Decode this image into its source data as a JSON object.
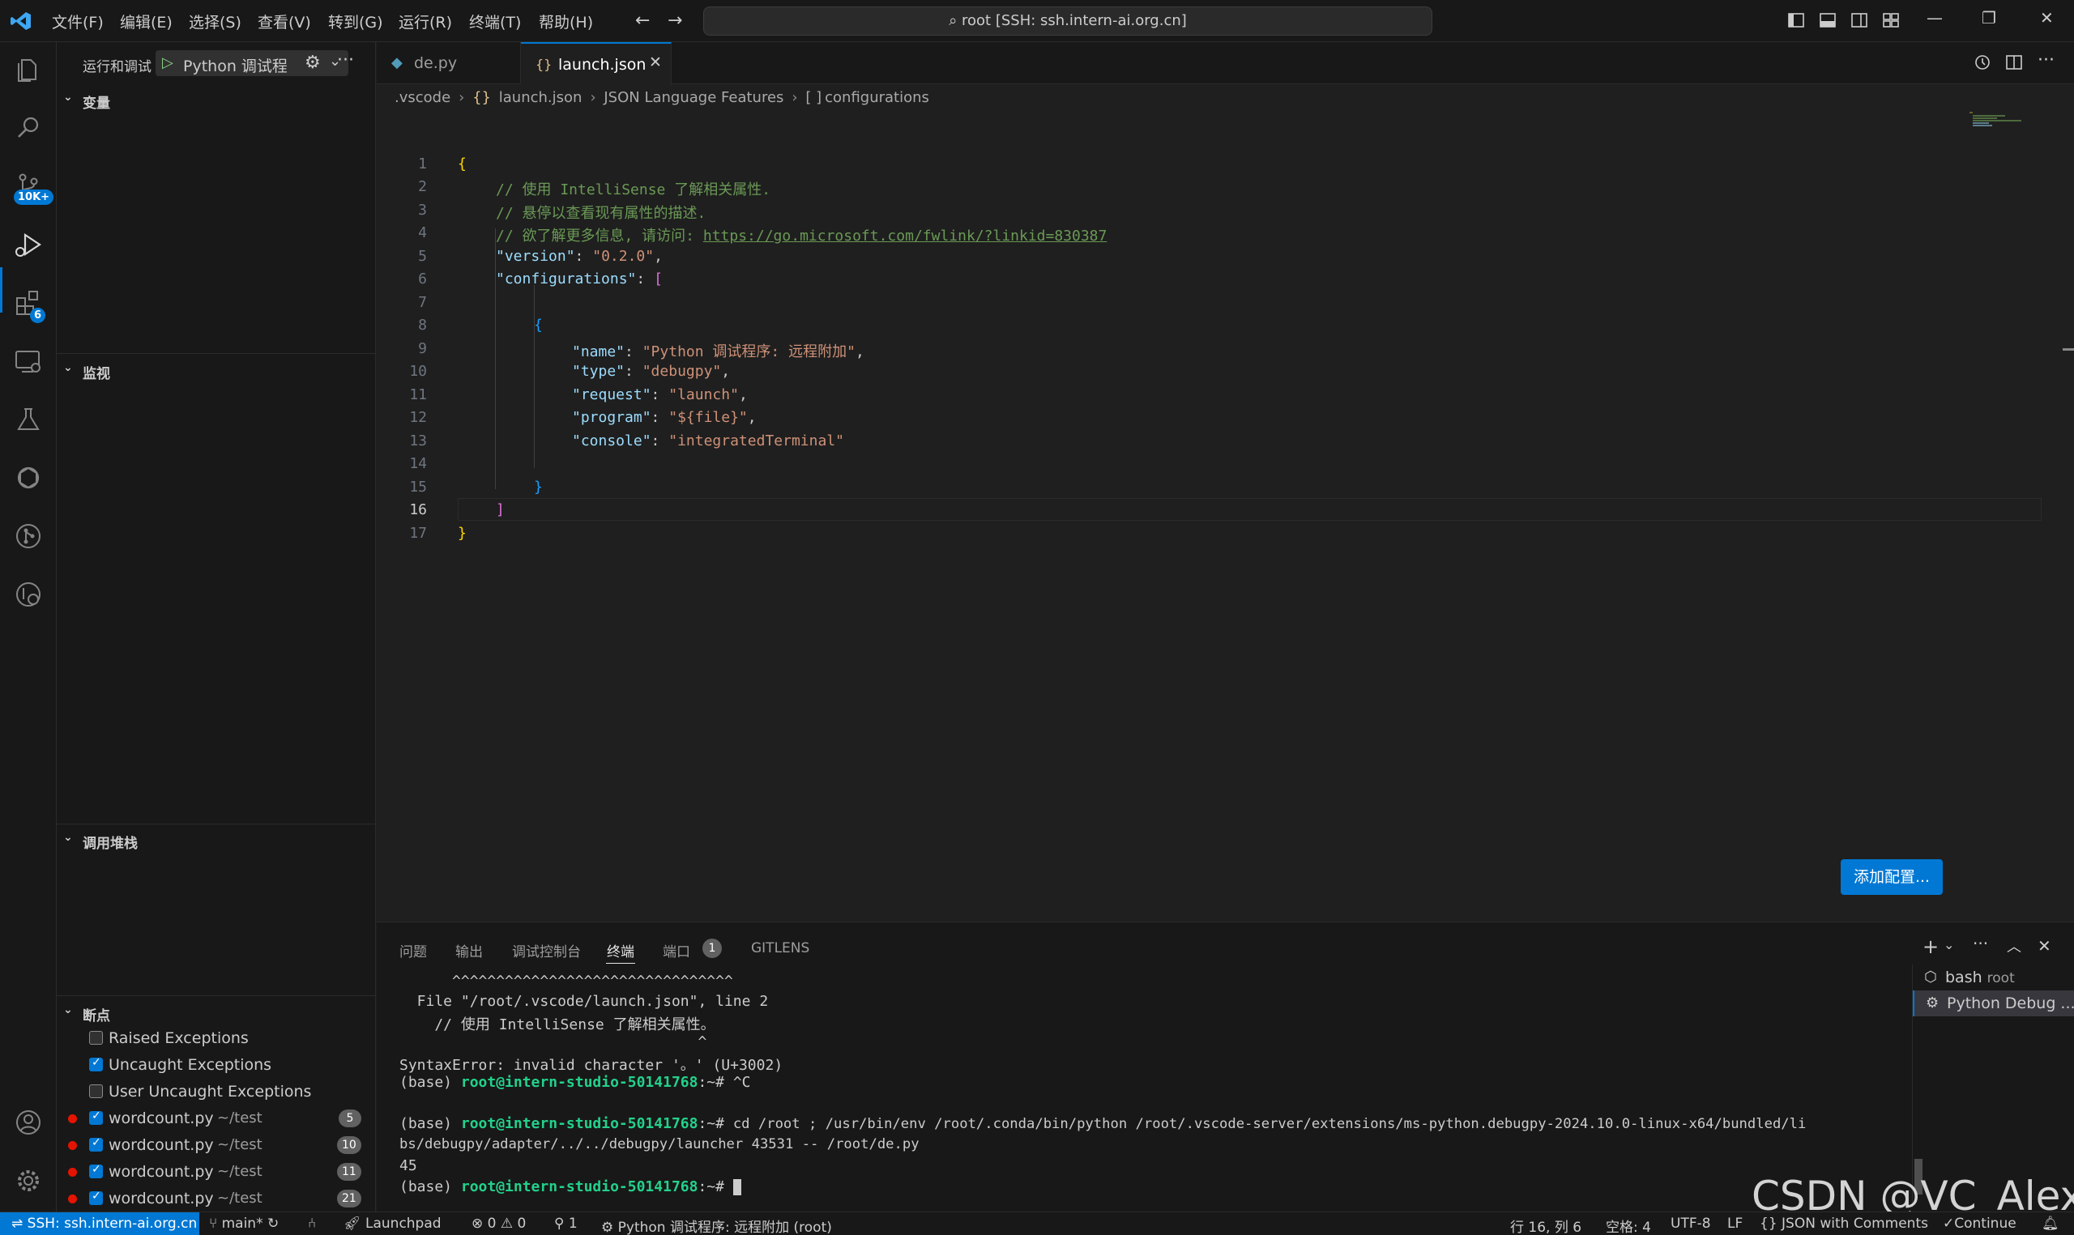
{
  "menu": [
    "文件(F)",
    "编辑(E)",
    "选择(S)",
    "查看(V)",
    "转到(G)",
    "运行(R)",
    "终端(T)",
    "帮助(H)"
  ],
  "command_center": "root [SSH: ssh.intern-ai.org.cn]",
  "activity": {
    "scm_badge": "10K+",
    "extensions_badge": "6"
  },
  "sidebar": {
    "title": "运行和调试",
    "launch_config": "Python 调试程序: 远程附加",
    "sections": {
      "variables": "变量",
      "watch": "监视",
      "callstack": "调用堆栈",
      "breakpoints": "断点"
    },
    "exceptions": [
      {
        "label": "Raised Exceptions",
        "checked": false
      },
      {
        "label": "Uncaught Exceptions",
        "checked": true
      },
      {
        "label": "User Uncaught Exceptions",
        "checked": false
      }
    ],
    "breakpoints": [
      {
        "file": "wordcount.py",
        "path": "~/test",
        "line": "5"
      },
      {
        "file": "wordcount.py",
        "path": "~/test",
        "line": "10"
      },
      {
        "file": "wordcount.py",
        "path": "~/test",
        "line": "11"
      },
      {
        "file": "wordcount.py",
        "path": "~/test",
        "line": "21"
      }
    ]
  },
  "tabs": [
    {
      "label": "de.py",
      "icon": "python-file-icon"
    },
    {
      "label": "launch.json",
      "icon": "json-file-icon"
    }
  ],
  "breadcrumb": [
    ".vscode",
    "launch.json",
    "JSON Language Features",
    "configurations"
  ],
  "code": {
    "line_numbers": [
      "1",
      "2",
      "3",
      "4",
      "5",
      "6",
      "7",
      "8",
      "9",
      "10",
      "11",
      "12",
      "13",
      "14",
      "15",
      "16",
      "17"
    ],
    "l1": "{",
    "l2": "// 使用 IntelliSense 了解相关属性.",
    "l3": "// 悬停以查看现有属性的描述.",
    "l4_comment": "// 欲了解更多信息, 请访问: ",
    "l4_link": "https://go.microsoft.com/fwlink/?linkid=830387",
    "l5_key": "\"version\"",
    "l5_val": "\"0.2.0\"",
    "l6_key": "\"configurations\"",
    "l6_open": "[",
    "l8": "{",
    "l9_key": "\"name\"",
    "l9_val": "\"Python 调试程序: 远程附加\"",
    "l10_key": "\"type\"",
    "l10_val": "\"debugpy\"",
    "l11_key": "\"request\"",
    "l11_val": "\"launch\"",
    "l12_key": "\"program\"",
    "l12_val": "\"${file}\"",
    "l13_key": "\"console\"",
    "l13_val": "\"integratedTerminal\"",
    "l15": "}",
    "l16": "]",
    "l17": "}"
  },
  "add_config_button": "添加配置...",
  "panel": {
    "tabs": [
      "问题",
      "输出",
      "调试控制台",
      "终端",
      "端口",
      "GITLENS"
    ],
    "ports_badge": "1",
    "terminal_lines": [
      "      ^^^^^^^^^^^^^^^^^^^^^^^^^^^^^^^^",
      "  File \"/root/.vscode/launch.json\", line 2",
      "    // 使用 IntelliSense 了解相关属性。",
      "                                  ^",
      "SyntaxError: invalid character '。' (U+3002)"
    ],
    "prompt_prefix": "(base) ",
    "prompt_host": "root@intern-studio-50141768",
    "prompt_suffix": ":~# ",
    "cmd1": "^C",
    "cmd2": "cd /root ; /usr/bin/env /root/.conda/bin/python /root/.vscode-server/extensions/ms-python.debugpy-2024.10.0-linux-x64/bundled/li",
    "cmd2_cont": "bs/debugpy/adapter/../../debugpy/launcher 43531 -- /root/de.py",
    "output": "45",
    "terminal_list": [
      {
        "label": "bash",
        "sub": "root"
      },
      {
        "label": "Python Debug ...",
        "sub": ""
      }
    ]
  },
  "watermark": "CSDN @VC_Alexa",
  "status": {
    "remote": "SSH: ssh.intern-ai.org.cn",
    "branch": "main*",
    "launchpad": "Launchpad",
    "errors": "0",
    "warnings": "0",
    "ports": "1",
    "debug_config": "Python 调试程序: 远程附加 (root)",
    "position": "行 16, 列 6",
    "spaces": "空格: 4",
    "encoding": "UTF-8",
    "eol": "LF",
    "language": "JSON with Comments",
    "continue": "Continue"
  },
  "colors": {
    "accent": "#0078d4",
    "terminal_green": "#23d18b",
    "breakpoint_red": "#e51400"
  }
}
